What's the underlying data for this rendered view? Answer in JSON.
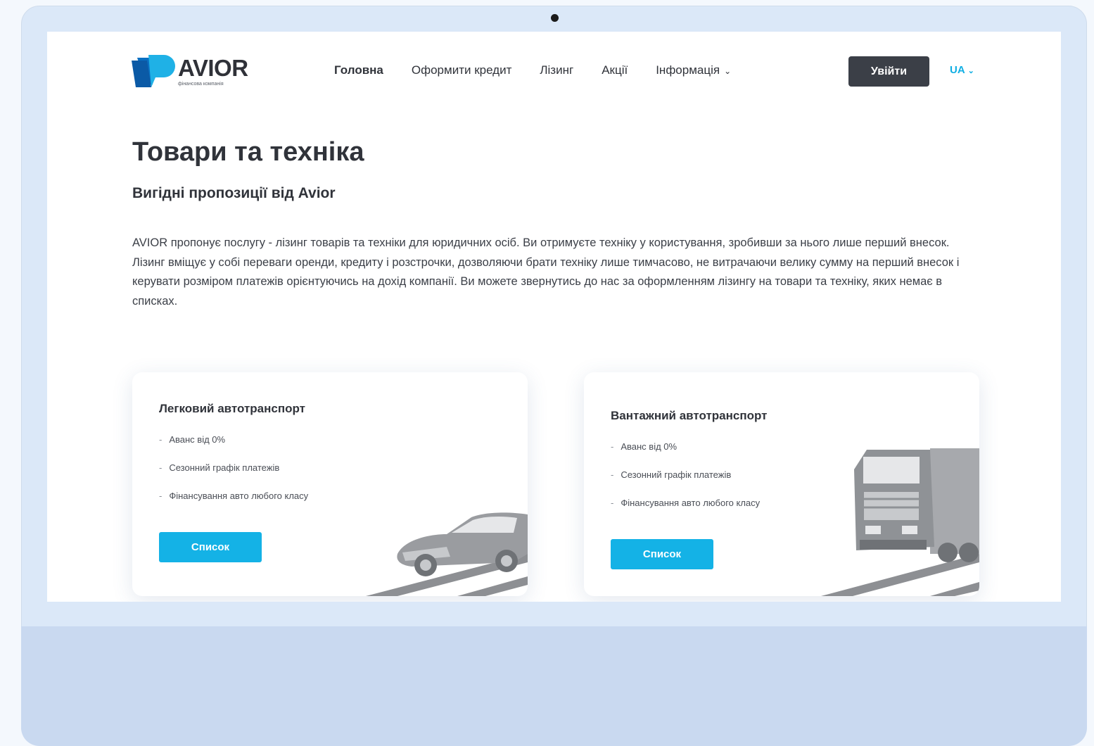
{
  "brand": {
    "name": "AVIOR",
    "tagline": "фінансова компанія",
    "colors": {
      "primary": "#14b2e6",
      "dark": "#3b3f47"
    }
  },
  "nav": {
    "items": [
      "Головна",
      "Оформити кредит",
      "Лізинг",
      "Акції",
      "Інформація"
    ],
    "active": "Головна",
    "login_label": "Увійти",
    "lang": "UA"
  },
  "hero": {
    "title": "Товари та техніка",
    "subtitle": "Вигідні пропозиції від Avior",
    "description": "AVIOR пропонує послугу - лізинг товарів та техніки для юридичних осіб. Ви отримуєте техніку у користування, зробивши за нього лише перший внесок. Лізинг вміщує у собі переваги оренди, кредиту і розстрочки, дозволяючи брати техніку лише тимчасово, не витрачаючи велику сумму на перший внесок і керувати розміром платежів орієнтуючись на дохід компанії. Ви можете звернутись до нас за оформленням лізингу на товари та техніку, яких немає в списках."
  },
  "cards": [
    {
      "title": "Легковий автотранспорт",
      "features": [
        "Аванс від 0%",
        "Сезонний графік платежів",
        "Фінансування авто любого класу"
      ],
      "button": "Список",
      "icon": "car-illustration"
    },
    {
      "title": "Вантажний автотранспорт",
      "features": [
        "Аванс від 0%",
        "Сезонний графік платежів",
        "Фінансування авто любого класу"
      ],
      "button": "Список",
      "icon": "truck-illustration"
    }
  ]
}
